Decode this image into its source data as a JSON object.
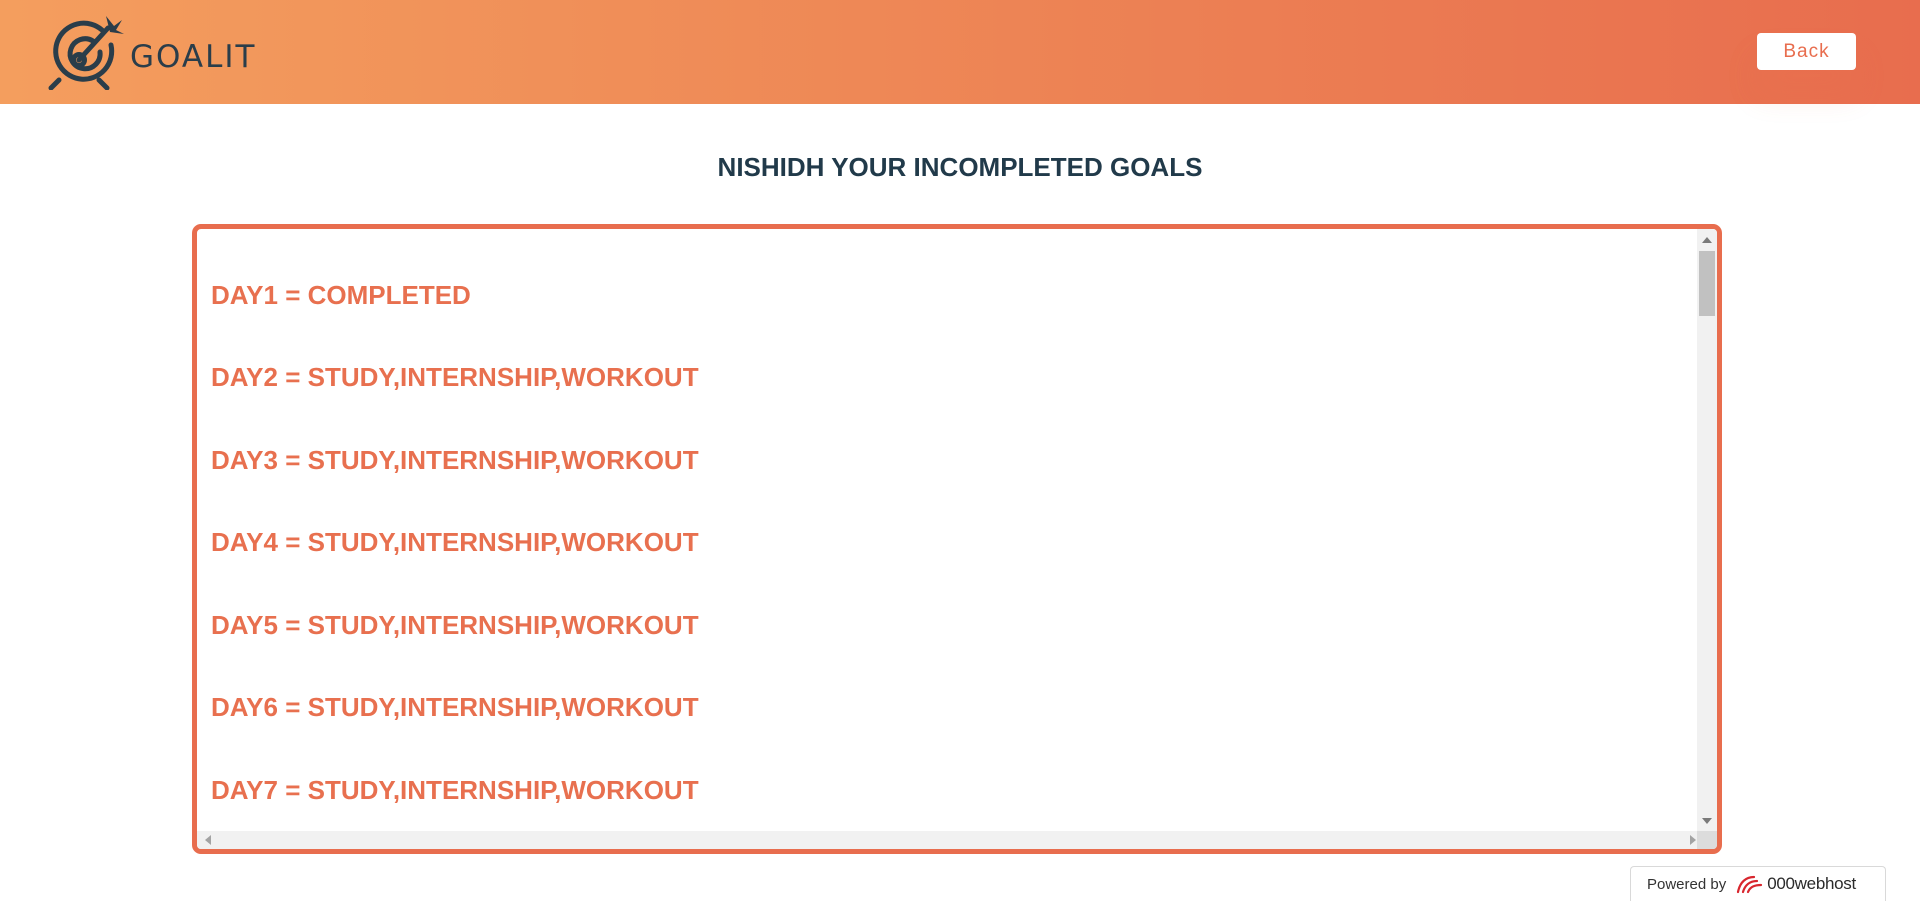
{
  "header": {
    "brand": "GOALIT",
    "back_label": "Back"
  },
  "main": {
    "title": "NISHIDH YOUR INCOMPLETED GOALS",
    "goals": [
      "DAY1 = COMPLETED",
      "DAY2 = STUDY,INTERNSHIP,WORKOUT",
      "DAY3 = STUDY,INTERNSHIP,WORKOUT",
      "DAY4 = STUDY,INTERNSHIP,WORKOUT",
      "DAY5 = STUDY,INTERNSHIP,WORKOUT",
      "DAY6 = STUDY,INTERNSHIP,WORKOUT",
      "DAY7 = STUDY,INTERNSHIP,WORKOUT"
    ]
  },
  "footer": {
    "powered_label": "Powered by",
    "powered_brand": "000webhost"
  },
  "colors": {
    "accent": "#e86d4e",
    "header_start": "#f49e5e",
    "title_text": "#213a4a"
  },
  "icons": [
    "target-arrow-icon",
    "000webhost-logo-icon"
  ]
}
